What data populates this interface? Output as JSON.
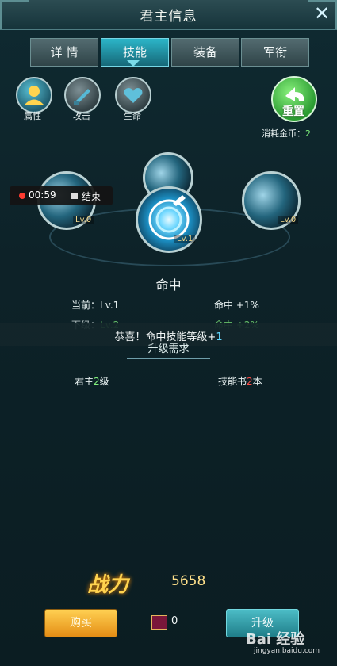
{
  "window": {
    "title": "君主信息"
  },
  "tabs": [
    {
      "label": "详 情"
    },
    {
      "label": "技能"
    },
    {
      "label": "装备"
    },
    {
      "label": "军衔"
    }
  ],
  "subtabs": [
    {
      "label": "属性"
    },
    {
      "label": "攻击"
    },
    {
      "label": "生命"
    }
  ],
  "reset": {
    "label": "重置"
  },
  "cost": {
    "label": "消耗金币：",
    "value": "2"
  },
  "recording": {
    "time": "00:59",
    "stop_label": "结束"
  },
  "skills": [
    {
      "level": "Lv.0"
    },
    {
      "level": "Lv.1"
    },
    {
      "level": "Lv.0"
    }
  ],
  "skill": {
    "name": "命中",
    "current_label": "当前：",
    "current_level": "Lv.1",
    "current_effect": "命中 +1%",
    "next_label": "下级：",
    "next_level": "Lv.2",
    "next_effect": "命中 +2%",
    "notice_prefix": "恭喜！命中技能等级+",
    "notice_value": "1",
    "requirements_title": "升级需求",
    "req_level_prefix": "君主",
    "req_level_value": "2",
    "req_level_suffix": "级",
    "req_book_prefix": "技能书",
    "req_book_value": "2",
    "req_book_suffix": "本"
  },
  "power": {
    "label": "战力",
    "value": "5658"
  },
  "buttons": {
    "buy": "购买",
    "upgrade": "升级"
  },
  "inventory": {
    "book_count": "0"
  },
  "watermark": {
    "line1": "Bai 经验",
    "line2": "jingyan.baidu.com"
  },
  "colors": {
    "accent": "#2cb5c8",
    "gold": "#ffd34f",
    "green": "#83f27d",
    "red": "#ff4c47"
  }
}
